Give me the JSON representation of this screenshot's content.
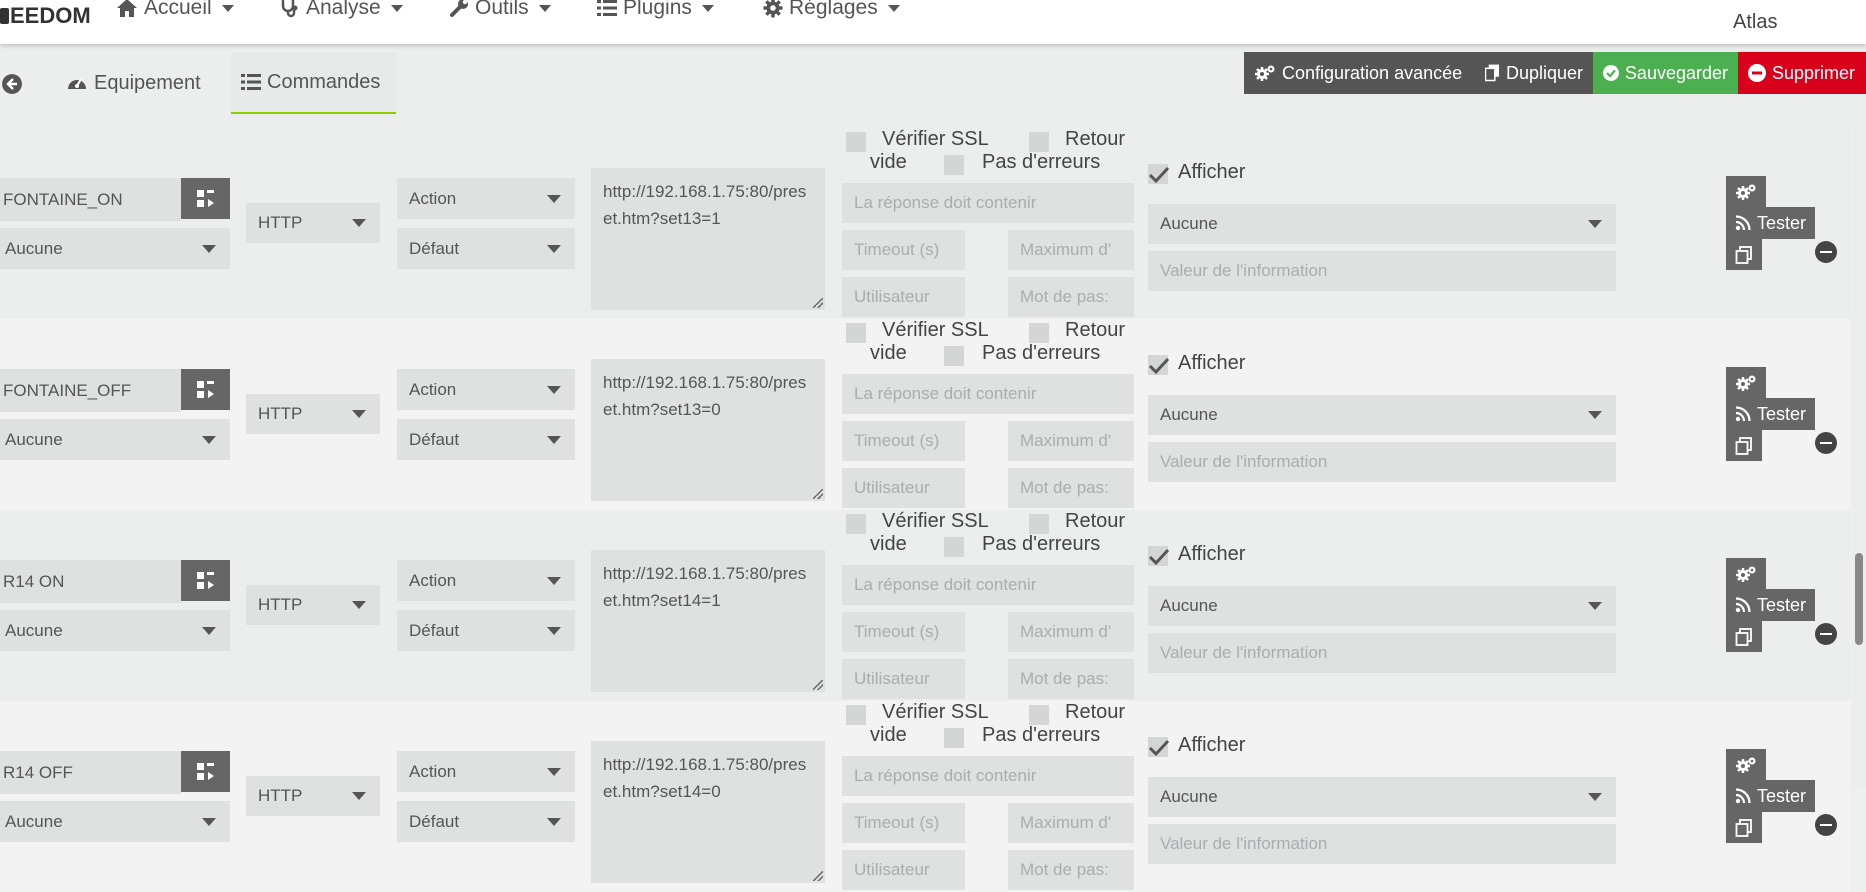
{
  "navbar": {
    "logo_text": "EEDOM",
    "items": [
      {
        "label": "Accueil",
        "icon": "home-icon"
      },
      {
        "label": "Analyse",
        "icon": "stethoscope-icon"
      },
      {
        "label": "Outils",
        "icon": "wrench-icon"
      },
      {
        "label": "Plugins",
        "icon": "list-icon"
      },
      {
        "label": "Réglages",
        "icon": "gear-icon"
      }
    ],
    "user": "Atlas"
  },
  "tabs": [
    {
      "label": "Equipement",
      "icon": "tachometer-icon"
    },
    {
      "label": "Commandes",
      "icon": "list-icon",
      "active": true
    }
  ],
  "actions": {
    "advanced": "Configuration avancée",
    "duplicate": "Dupliquer",
    "save": "Sauvegarder",
    "delete": "Supprimer"
  },
  "colors": {
    "save": "#4caf50",
    "delete": "#d9001b",
    "dark": "#555555",
    "accent": "#94ca02"
  },
  "labels": {
    "verify_ssl": "Vérifier SSL",
    "retour": "Retour",
    "vide": "vide",
    "no_errors": "Pas d'erreurs",
    "afficher": "Afficher",
    "tester": "Tester"
  },
  "placeholders": {
    "response": "La réponse doit contenir",
    "timeout": "Timeout (s)",
    "maximum": "Maximum d'",
    "user": "Utilisateur",
    "password": "Mot de pas:",
    "info_value": "Valeur de l'information"
  },
  "commands": [
    {
      "name": "FONTAINE_ON",
      "unit": "Aucune",
      "protocol": "HTTP",
      "type": "Action",
      "subtype": "Défaut",
      "url": "http://192.168.1.75:80/preset.htm?set13=1",
      "display_value": "Aucune"
    },
    {
      "name": "FONTAINE_OFF",
      "unit": "Aucune",
      "protocol": "HTTP",
      "type": "Action",
      "subtype": "Défaut",
      "url": "http://192.168.1.75:80/preset.htm?set13=0",
      "display_value": "Aucune"
    },
    {
      "name": "R14 ON",
      "unit": "Aucune",
      "protocol": "HTTP",
      "type": "Action",
      "subtype": "Défaut",
      "url": "http://192.168.1.75:80/preset.htm?set14=1",
      "display_value": "Aucune"
    },
    {
      "name": "R14 OFF",
      "unit": "Aucune",
      "protocol": "HTTP",
      "type": "Action",
      "subtype": "Défaut",
      "url": "http://192.168.1.75:80/preset.htm?set14=0",
      "display_value": "Aucune"
    }
  ]
}
